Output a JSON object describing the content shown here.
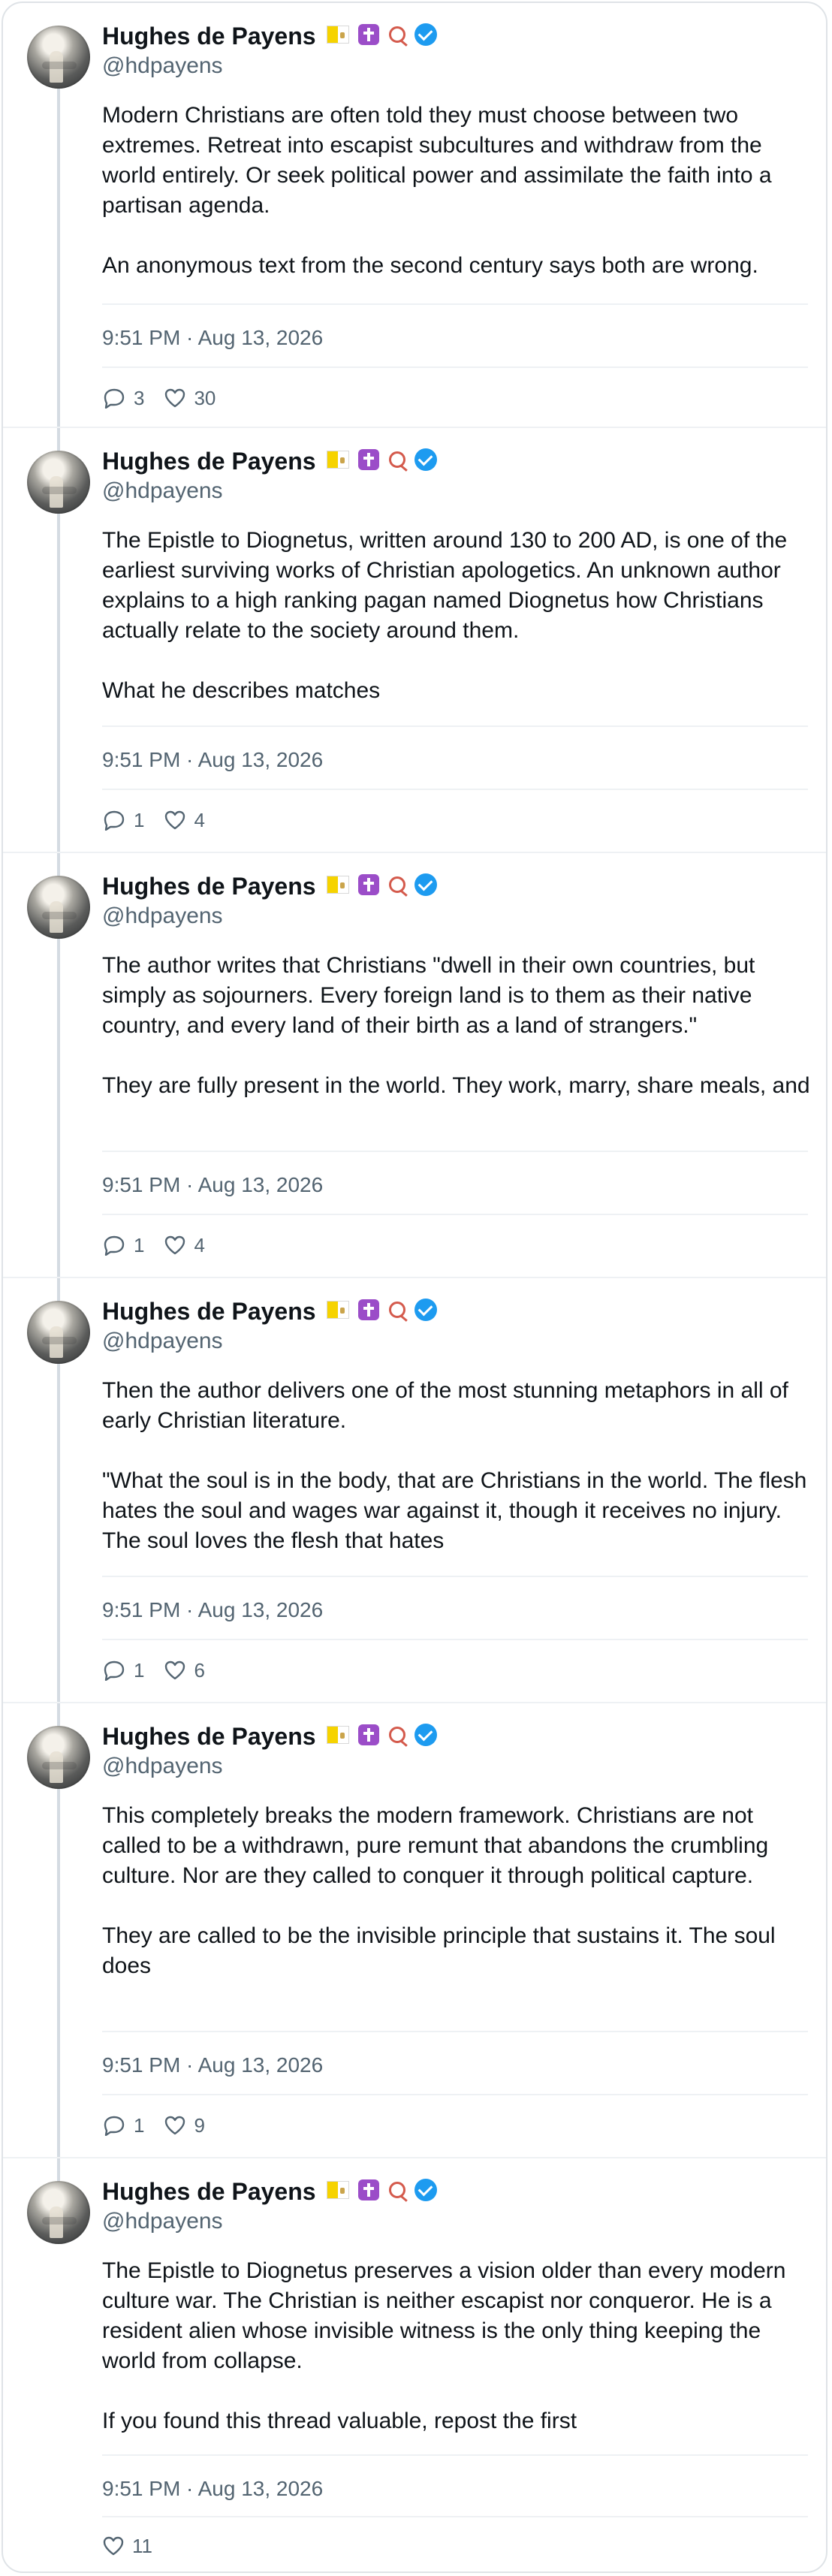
{
  "author": {
    "name": "Hughes de Payens",
    "handle": "@hdpayens",
    "badges": [
      "vatican-flag-icon",
      "latin-cross-icon",
      "rosary-icon",
      "verified-badge-icon"
    ]
  },
  "tweets": [
    {
      "paragraphs": [
        "Modern Christians are often told they must choose between two extremes. Retreat into escapist subcultures and withdraw from the world entirely. Or seek political power and assimilate the faith into a partisan agenda.",
        "An anonymous text from the second century says both are wrong."
      ],
      "timestamp": "9:51 PM · Aug 13, 2026",
      "replies": "3",
      "likes": "30"
    },
    {
      "paragraphs": [
        "The Epistle to Diognetus, written around 130 to 200 AD, is one of the earliest surviving works of Christian apologetics. An unknown author explains to a high ranking pagan named Diognetus how Christians actually relate to the society around them.",
        "What he describes matches"
      ],
      "timestamp": "9:51 PM · Aug 13, 2026",
      "replies": "1",
      "likes": "4"
    },
    {
      "paragraphs": [
        "The author writes that Christians \"dwell in their own countries, but simply as sojourners. Every foreign land is to them as their native country, and every land of their birth as a land of strangers.\"",
        "They are fully present in the world. They work, marry, share meals, and"
      ],
      "timestamp": "9:51 PM · Aug 13, 2026",
      "replies": "1",
      "likes": "4"
    },
    {
      "paragraphs": [
        "Then the author delivers one of the most stunning metaphors in all of early Christian literature.",
        "\"What the soul is in the body, that are Christians in the world. The flesh hates the soul and wages war against it, though it receives no injury. The soul loves the flesh that hates"
      ],
      "timestamp": "9:51 PM · Aug 13, 2026",
      "replies": "1",
      "likes": "6"
    },
    {
      "paragraphs": [
        "This completely breaks the modern framework. Christians are not called to be a withdrawn, pure remunt that abandons the crumbling culture. Nor are they called to conquer it through political capture.",
        "They are called to be the invisible principle that sustains it. The soul does"
      ],
      "timestamp": "9:51 PM · Aug 13, 2026",
      "replies": "1",
      "likes": "9"
    },
    {
      "paragraphs": [
        "The Epistle to Diognetus preserves a vision older than every modern culture war. The Christian is neither escapist nor conqueror. He is a resident alien whose invisible witness is the only thing keeping the world from collapse.",
        "If you found this thread valuable, repost the first"
      ],
      "timestamp": "9:51 PM · Aug 13, 2026",
      "replies": "",
      "likes": "11"
    }
  ]
}
